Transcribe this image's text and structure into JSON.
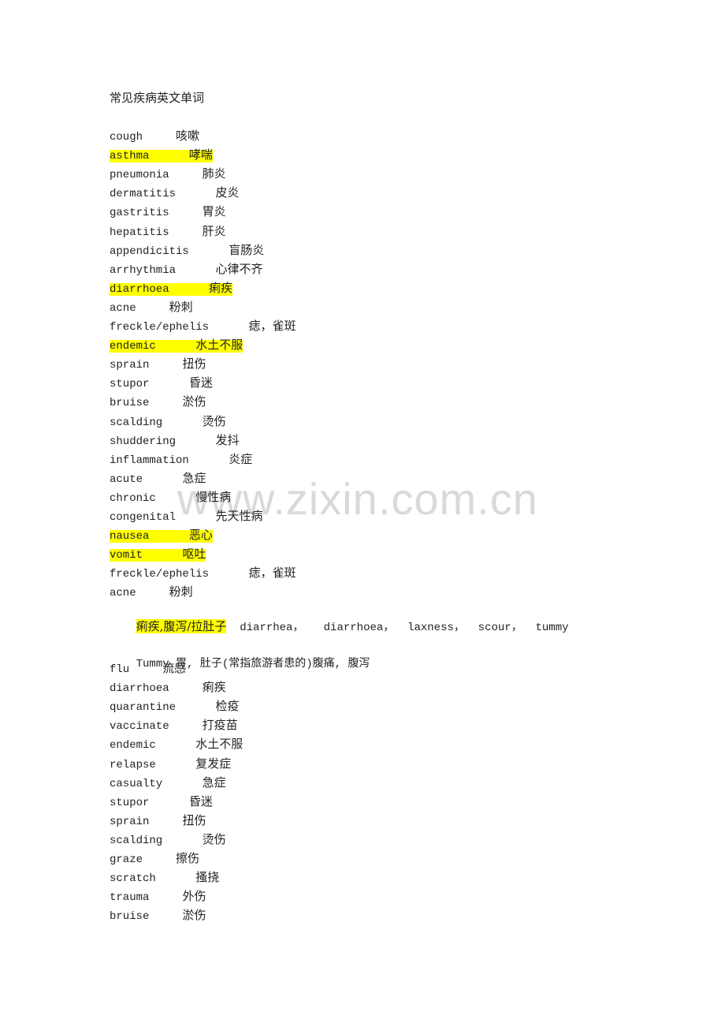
{
  "document": {
    "title": "常见疾病英文单词",
    "watermark": "www.zixin.com.cn",
    "highlight_color": "#ffff00",
    "entries": [
      {
        "en": "cough",
        "gap": "     ",
        "zh": "咳嗽",
        "highlight": false
      },
      {
        "en": "asthma",
        "gap": "      ",
        "zh": "哮喘",
        "highlight": true
      },
      {
        "en": "pneumonia",
        "gap": "     ",
        "zh": "肺炎",
        "highlight": false
      },
      {
        "en": "dermatitis",
        "gap": "      ",
        "zh": "皮炎",
        "highlight": false
      },
      {
        "en": "gastritis",
        "gap": "     ",
        "zh": "胃炎",
        "highlight": false
      },
      {
        "en": "hepatitis",
        "gap": "     ",
        "zh": "肝炎",
        "highlight": false
      },
      {
        "en": "appendicitis",
        "gap": "      ",
        "zh": "盲肠炎",
        "highlight": false
      },
      {
        "en": "arrhythmia",
        "gap": "      ",
        "zh": "心律不齐",
        "highlight": false
      },
      {
        "en": "diarrhoea",
        "gap": "      ",
        "zh": "痢疾",
        "highlight": true
      },
      {
        "en": "acne",
        "gap": "     ",
        "zh": "粉刺",
        "highlight": false
      },
      {
        "en": "freckle/ephelis",
        "gap": "      ",
        "zh": "痣，雀斑",
        "highlight": false
      },
      {
        "en": "endemic",
        "gap": "      ",
        "zh": "水土不服",
        "highlight": true
      },
      {
        "en": "sprain",
        "gap": "     ",
        "zh": "扭伤",
        "highlight": false
      },
      {
        "en": "stupor",
        "gap": "      ",
        "zh": "昏迷",
        "highlight": false
      },
      {
        "en": "bruise",
        "gap": "     ",
        "zh": "淤伤",
        "highlight": false
      },
      {
        "en": "scalding",
        "gap": "      ",
        "zh": "烫伤",
        "highlight": false
      },
      {
        "en": "shuddering",
        "gap": "      ",
        "zh": "发抖",
        "highlight": false
      },
      {
        "en": "inflammation",
        "gap": "      ",
        "zh": "炎症",
        "highlight": false
      },
      {
        "en": "acute",
        "gap": "      ",
        "zh": "急症",
        "highlight": false
      },
      {
        "en": "chronic",
        "gap": "      ",
        "zh": "慢性病",
        "highlight": false
      },
      {
        "en": "congenital",
        "gap": "      ",
        "zh": "先天性病",
        "highlight": false
      },
      {
        "en": "nausea",
        "gap": "      ",
        "zh": "恶心",
        "highlight": true
      },
      {
        "en": "vomit",
        "gap": "      ",
        "zh": "呕吐",
        "highlight": true
      },
      {
        "en": "freckle/ephelis",
        "gap": "      ",
        "zh": "痣，雀斑",
        "highlight": false
      },
      {
        "en": "acne",
        "gap": "     ",
        "zh": "粉刺",
        "highlight": false
      }
    ],
    "synonym_line": {
      "zh": "痢疾,腹泻/拉肚子",
      "en": "  diarrhea，   diarrhoea，  laxness，  scour，  tummy"
    },
    "tummy_line": "Tummy 胃, 肚子(常指旅游者患的)腹痛, 腹泻",
    "entries2": [
      {
        "en": "flu",
        "gap": "     ",
        "zh": "流感"
      },
      {
        "en": "diarrhoea",
        "gap": "     ",
        "zh": "痢疾"
      },
      {
        "en": "quarantine",
        "gap": "      ",
        "zh": "检疫"
      },
      {
        "en": "vaccinate",
        "gap": "     ",
        "zh": "打疫苗"
      },
      {
        "en": "endemic",
        "gap": "      ",
        "zh": "水土不服"
      },
      {
        "en": "relapse",
        "gap": "      ",
        "zh": "复发症"
      },
      {
        "en": "casualty",
        "gap": "      ",
        "zh": "急症"
      },
      {
        "en": "stupor",
        "gap": "      ",
        "zh": "昏迷"
      },
      {
        "en": "sprain",
        "gap": "     ",
        "zh": "扭伤"
      },
      {
        "en": "scalding",
        "gap": "      ",
        "zh": "烫伤"
      },
      {
        "en": "graze",
        "gap": "     ",
        "zh": "擦伤"
      },
      {
        "en": "scratch",
        "gap": "      ",
        "zh": "搔挠"
      },
      {
        "en": "trauma",
        "gap": "     ",
        "zh": "外伤"
      },
      {
        "en": "bruise",
        "gap": "     ",
        "zh": "淤伤"
      }
    ]
  }
}
